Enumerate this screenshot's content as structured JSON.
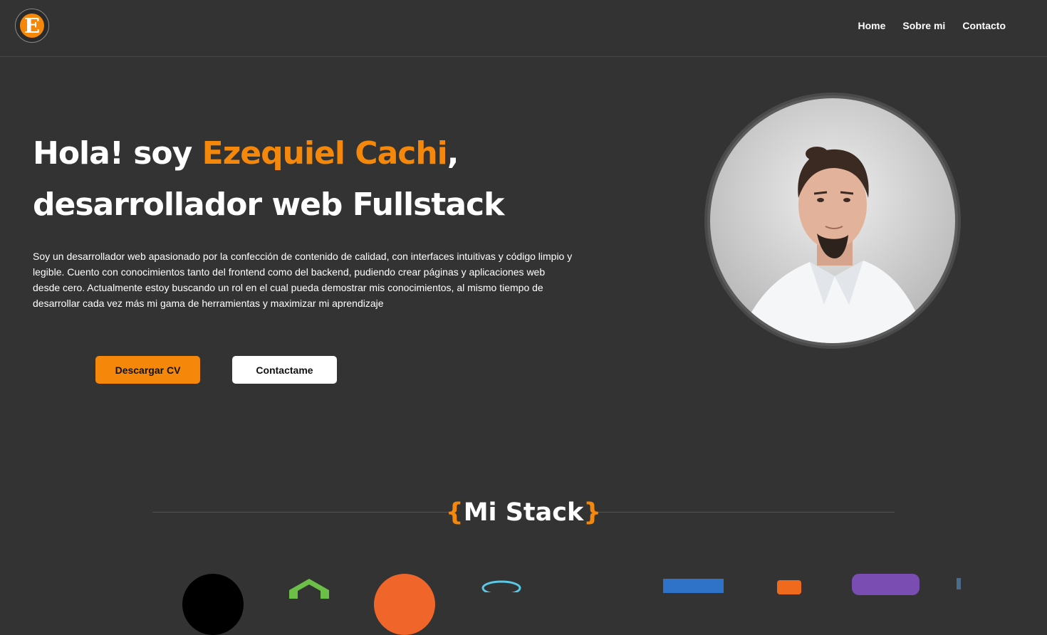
{
  "navbar": {
    "logo_letter": "E",
    "links": [
      "Home",
      "Sobre mi",
      "Contacto"
    ]
  },
  "hero": {
    "greeting": "Hola! soy ",
    "name": "Ezequiel Cachi",
    "comma": ",",
    "role": "desarrollador web Fullstack",
    "description": "Soy un desarrollador web apasionado por la confección de contenido de calidad, con interfaces intuitivas y código limpio y legible. Cuento con conocimientos tanto del frontend como del backend, pudiendo crear páginas y aplicaciones web desde cero. Actualmente estoy buscando un rol en el cual pueda demostrar mis conocimientos, al mismo tiempo de desarrollar cada vez más mi gama de herramientas y maximizar mi aprendizaje",
    "btn_cv": "Descargar CV",
    "btn_contact": "Contactame"
  },
  "stack": {
    "open_brace": "{",
    "title": "Mi Stack",
    "close_brace": "}"
  },
  "colors": {
    "accent": "#f5880b",
    "background": "#333333"
  }
}
